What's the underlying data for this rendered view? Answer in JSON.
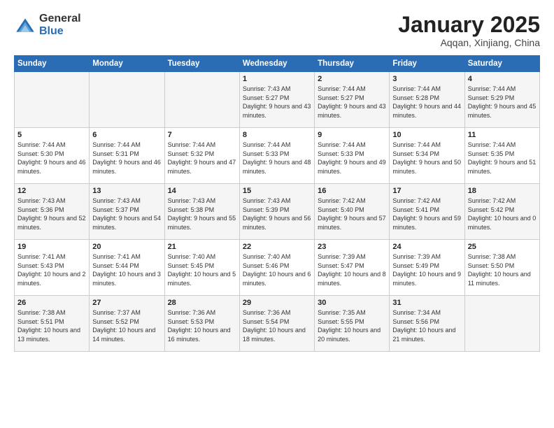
{
  "header": {
    "logo_general": "General",
    "logo_blue": "Blue",
    "title": "January 2025",
    "subtitle": "Aqqan, Xinjiang, China"
  },
  "days_of_week": [
    "Sunday",
    "Monday",
    "Tuesday",
    "Wednesday",
    "Thursday",
    "Friday",
    "Saturday"
  ],
  "weeks": [
    [
      {
        "day": "",
        "info": ""
      },
      {
        "day": "",
        "info": ""
      },
      {
        "day": "",
        "info": ""
      },
      {
        "day": "1",
        "info": "Sunrise: 7:43 AM\nSunset: 5:27 PM\nDaylight: 9 hours and 43 minutes."
      },
      {
        "day": "2",
        "info": "Sunrise: 7:44 AM\nSunset: 5:27 PM\nDaylight: 9 hours and 43 minutes."
      },
      {
        "day": "3",
        "info": "Sunrise: 7:44 AM\nSunset: 5:28 PM\nDaylight: 9 hours and 44 minutes."
      },
      {
        "day": "4",
        "info": "Sunrise: 7:44 AM\nSunset: 5:29 PM\nDaylight: 9 hours and 45 minutes."
      }
    ],
    [
      {
        "day": "5",
        "info": "Sunrise: 7:44 AM\nSunset: 5:30 PM\nDaylight: 9 hours and 46 minutes."
      },
      {
        "day": "6",
        "info": "Sunrise: 7:44 AM\nSunset: 5:31 PM\nDaylight: 9 hours and 46 minutes."
      },
      {
        "day": "7",
        "info": "Sunrise: 7:44 AM\nSunset: 5:32 PM\nDaylight: 9 hours and 47 minutes."
      },
      {
        "day": "8",
        "info": "Sunrise: 7:44 AM\nSunset: 5:33 PM\nDaylight: 9 hours and 48 minutes."
      },
      {
        "day": "9",
        "info": "Sunrise: 7:44 AM\nSunset: 5:33 PM\nDaylight: 9 hours and 49 minutes."
      },
      {
        "day": "10",
        "info": "Sunrise: 7:44 AM\nSunset: 5:34 PM\nDaylight: 9 hours and 50 minutes."
      },
      {
        "day": "11",
        "info": "Sunrise: 7:44 AM\nSunset: 5:35 PM\nDaylight: 9 hours and 51 minutes."
      }
    ],
    [
      {
        "day": "12",
        "info": "Sunrise: 7:43 AM\nSunset: 5:36 PM\nDaylight: 9 hours and 52 minutes."
      },
      {
        "day": "13",
        "info": "Sunrise: 7:43 AM\nSunset: 5:37 PM\nDaylight: 9 hours and 54 minutes."
      },
      {
        "day": "14",
        "info": "Sunrise: 7:43 AM\nSunset: 5:38 PM\nDaylight: 9 hours and 55 minutes."
      },
      {
        "day": "15",
        "info": "Sunrise: 7:43 AM\nSunset: 5:39 PM\nDaylight: 9 hours and 56 minutes."
      },
      {
        "day": "16",
        "info": "Sunrise: 7:42 AM\nSunset: 5:40 PM\nDaylight: 9 hours and 57 minutes."
      },
      {
        "day": "17",
        "info": "Sunrise: 7:42 AM\nSunset: 5:41 PM\nDaylight: 9 hours and 59 minutes."
      },
      {
        "day": "18",
        "info": "Sunrise: 7:42 AM\nSunset: 5:42 PM\nDaylight: 10 hours and 0 minutes."
      }
    ],
    [
      {
        "day": "19",
        "info": "Sunrise: 7:41 AM\nSunset: 5:43 PM\nDaylight: 10 hours and 2 minutes."
      },
      {
        "day": "20",
        "info": "Sunrise: 7:41 AM\nSunset: 5:44 PM\nDaylight: 10 hours and 3 minutes."
      },
      {
        "day": "21",
        "info": "Sunrise: 7:40 AM\nSunset: 5:45 PM\nDaylight: 10 hours and 5 minutes."
      },
      {
        "day": "22",
        "info": "Sunrise: 7:40 AM\nSunset: 5:46 PM\nDaylight: 10 hours and 6 minutes."
      },
      {
        "day": "23",
        "info": "Sunrise: 7:39 AM\nSunset: 5:47 PM\nDaylight: 10 hours and 8 minutes."
      },
      {
        "day": "24",
        "info": "Sunrise: 7:39 AM\nSunset: 5:49 PM\nDaylight: 10 hours and 9 minutes."
      },
      {
        "day": "25",
        "info": "Sunrise: 7:38 AM\nSunset: 5:50 PM\nDaylight: 10 hours and 11 minutes."
      }
    ],
    [
      {
        "day": "26",
        "info": "Sunrise: 7:38 AM\nSunset: 5:51 PM\nDaylight: 10 hours and 13 minutes."
      },
      {
        "day": "27",
        "info": "Sunrise: 7:37 AM\nSunset: 5:52 PM\nDaylight: 10 hours and 14 minutes."
      },
      {
        "day": "28",
        "info": "Sunrise: 7:36 AM\nSunset: 5:53 PM\nDaylight: 10 hours and 16 minutes."
      },
      {
        "day": "29",
        "info": "Sunrise: 7:36 AM\nSunset: 5:54 PM\nDaylight: 10 hours and 18 minutes."
      },
      {
        "day": "30",
        "info": "Sunrise: 7:35 AM\nSunset: 5:55 PM\nDaylight: 10 hours and 20 minutes."
      },
      {
        "day": "31",
        "info": "Sunrise: 7:34 AM\nSunset: 5:56 PM\nDaylight: 10 hours and 21 minutes."
      },
      {
        "day": "",
        "info": ""
      }
    ]
  ]
}
